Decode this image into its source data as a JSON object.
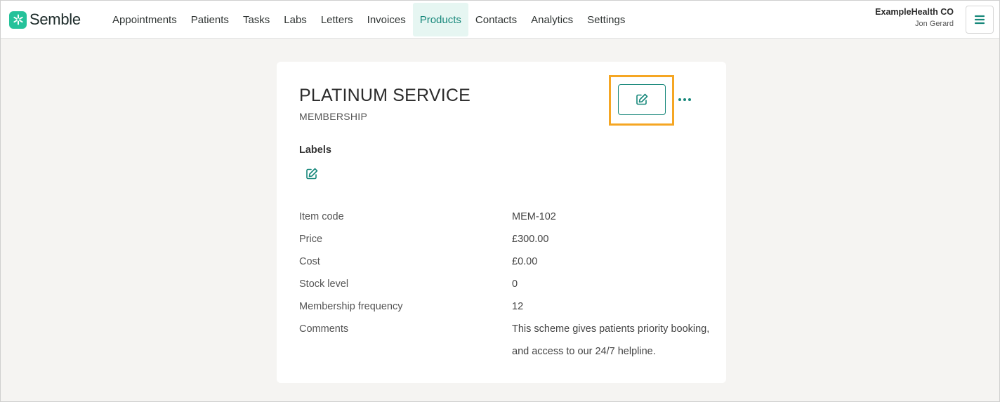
{
  "app": {
    "logo_text": "Semble"
  },
  "nav": {
    "items": [
      {
        "label": "Appointments",
        "active": false
      },
      {
        "label": "Patients",
        "active": false
      },
      {
        "label": "Tasks",
        "active": false
      },
      {
        "label": "Labs",
        "active": false
      },
      {
        "label": "Letters",
        "active": false
      },
      {
        "label": "Invoices",
        "active": false
      },
      {
        "label": "Products",
        "active": true
      },
      {
        "label": "Contacts",
        "active": false
      },
      {
        "label": "Analytics",
        "active": false
      },
      {
        "label": "Settings",
        "active": false
      }
    ]
  },
  "account": {
    "org": "ExampleHealth CO",
    "user": "Jon Gerard"
  },
  "product": {
    "title": "PLATINUM SERVICE",
    "type": "MEMBERSHIP",
    "labels_heading": "Labels",
    "details": [
      {
        "key": "Item code",
        "value": "MEM-102"
      },
      {
        "key": "Price",
        "value": "£300.00"
      },
      {
        "key": "Cost",
        "value": "£0.00"
      },
      {
        "key": "Stock level",
        "value": "0"
      },
      {
        "key": "Membership frequency",
        "value": "12"
      },
      {
        "key": "Comments",
        "value": "This scheme gives patients priority booking, and access to our 24/7 helpline."
      }
    ]
  },
  "colors": {
    "accent": "#16877a",
    "brand": "#25c29a",
    "highlight": "#f5a623"
  },
  "icons": {
    "edit": "pencil-square-icon",
    "more": "ellipsis-icon",
    "menu": "hamburger-icon"
  }
}
